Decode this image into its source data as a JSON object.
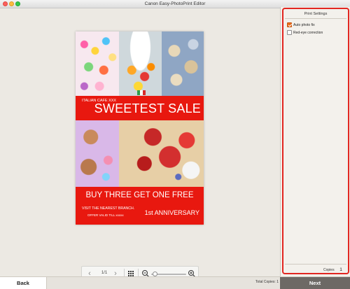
{
  "window": {
    "title": "Canon Easy-PhotoPrint Editor"
  },
  "poster": {
    "cafe_label": "ITALIAN CAFE XXX",
    "headline": "SWEETEST SALE",
    "promo": "BUY THREE GET ONE FREE",
    "visit": "VISIT THE NEAREST BRANCH.",
    "offer": "OFFER VALID TILL xxxxx",
    "anniversary": "1st ANNIVERSARY",
    "accent_color": "#e8180f",
    "flag_colors": [
      "#2e9d4a",
      "#ffffff",
      "#d72a2a"
    ]
  },
  "navigation": {
    "page_indicator": "1/1",
    "prev_icon": "chevron-left-icon",
    "next_icon": "chevron-right-icon",
    "thumbnails_icon": "grid-icon",
    "zoom_out_icon": "zoom-out-icon",
    "zoom_in_icon": "zoom-in-icon",
    "zoom_level": 0.05
  },
  "print_settings": {
    "title": "Print Settings",
    "options": [
      {
        "label": "Auto photo fix",
        "checked": true
      },
      {
        "label": "Red-eye correction",
        "checked": false
      }
    ],
    "copies_label": "Copies",
    "copies_value": "1",
    "highlight_color": "#e22620"
  },
  "footer": {
    "back_label": "Back",
    "total_copies": "Total Copies: 1",
    "next_label": "Next"
  }
}
